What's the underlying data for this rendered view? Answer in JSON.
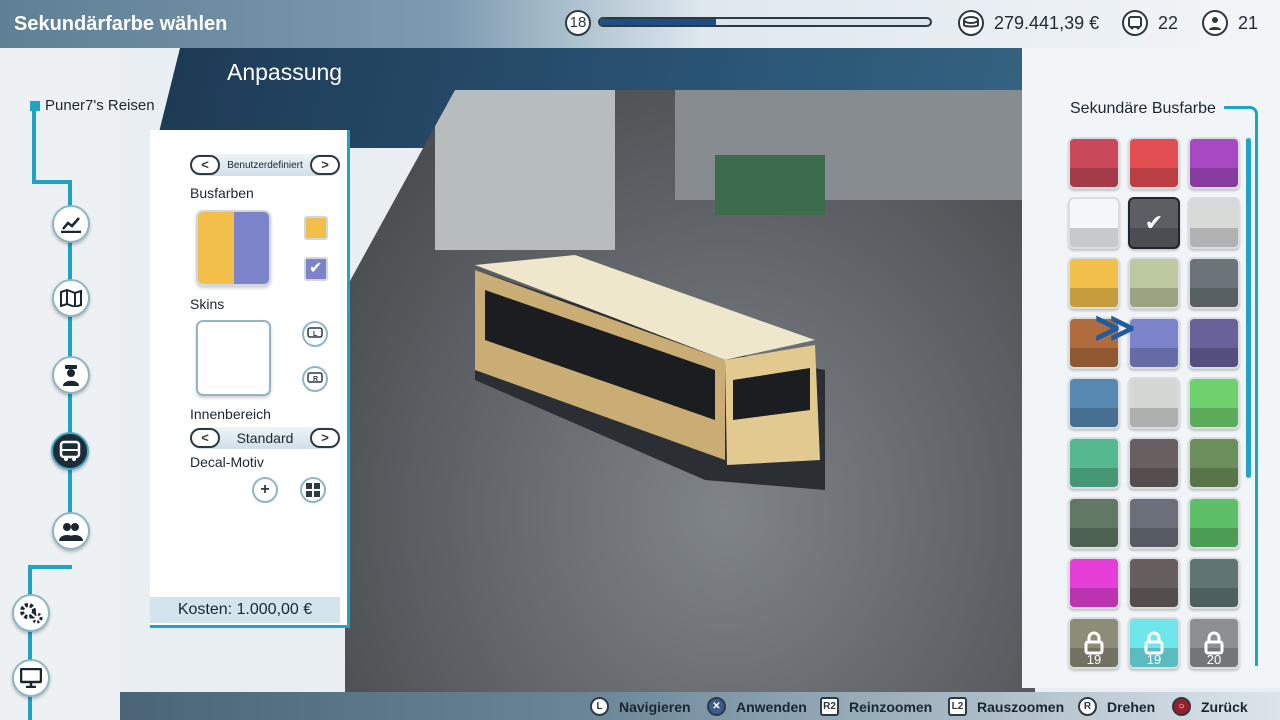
{
  "header": {
    "title": "Sekundärfarbe wählen",
    "level": "18",
    "xp_progress": 0.35,
    "money": "279.441,39 €",
    "buses": "22",
    "drivers": "21"
  },
  "sidebar": {
    "company": "Puner7's Reisen",
    "items": [
      {
        "name": "stats-icon"
      },
      {
        "name": "map-icon"
      },
      {
        "name": "driver-icon"
      },
      {
        "name": "bus-icon",
        "active": true
      },
      {
        "name": "group-icon"
      },
      {
        "name": "gears-icon"
      },
      {
        "name": "monitor-icon"
      }
    ]
  },
  "main": {
    "section_title": "Anpassung",
    "preset_label": "Benutzerdefiniert",
    "busfarben_label": "Busfarben",
    "skins_label": "Skins",
    "innenbereich_label": "Innenbereich",
    "innenbereich_value": "Standard",
    "decal_label": "Decal-Motiv",
    "cost": "Kosten: 1.000,00 €",
    "primary_color": "#f2c04a",
    "secondary_color": "#7c83c8"
  },
  "palette": {
    "title": "Sekundäre Busfarbe",
    "colors": [
      {
        "hex": "#c9485a"
      },
      {
        "hex": "#e34e52"
      },
      {
        "hex": "#a649c2"
      },
      {
        "hex": "#f4f6f8"
      },
      {
        "hex": "#5b5f64",
        "selected": true
      },
      {
        "hex": "#d8dad8"
      },
      {
        "hex": "#f2c04a"
      },
      {
        "hex": "#bcc8a0"
      },
      {
        "hex": "#6b7479"
      },
      {
        "hex": "#b06c3d"
      },
      {
        "hex": "#7c83c8",
        "cursor": true
      },
      {
        "hex": "#68619a"
      },
      {
        "hex": "#5688b2"
      },
      {
        "hex": "#d5d7d4"
      },
      {
        "hex": "#6ed16e"
      },
      {
        "hex": "#55b88e"
      },
      {
        "hex": "#6a5f60"
      },
      {
        "hex": "#6c8e5a"
      },
      {
        "hex": "#607864"
      },
      {
        "hex": "#6a6f7a"
      },
      {
        "hex": "#5dbf66"
      },
      {
        "hex": "#e53fd8"
      },
      {
        "hex": "#675f5f"
      },
      {
        "hex": "#5f7574"
      },
      {
        "hex": "#8c8c77",
        "locked": true,
        "level": "19"
      },
      {
        "hex": "#6fe6ea",
        "locked": true,
        "level": "19"
      },
      {
        "hex": "#8d8f94",
        "locked": true,
        "level": "20"
      }
    ]
  },
  "footer": {
    "hints": [
      {
        "glyph": "L",
        "label": "Navigieren"
      },
      {
        "glyph": "✕",
        "label": "Anwenden"
      },
      {
        "glyph": "R2",
        "label": "Reinzoomen"
      },
      {
        "glyph": "L2",
        "label": "Rauszoomen"
      },
      {
        "glyph": "R",
        "label": "Drehen"
      },
      {
        "glyph": "○",
        "label": "Zurück"
      }
    ]
  }
}
